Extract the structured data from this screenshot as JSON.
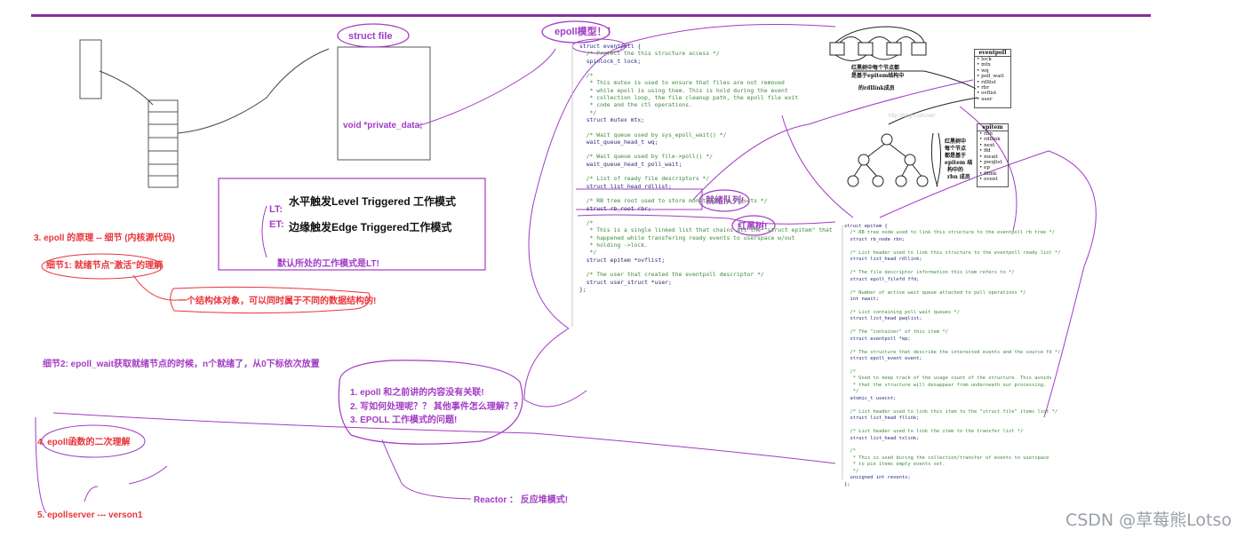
{
  "left_notes": {
    "struct_file": "struct file",
    "private_data": "void *private_data;",
    "lt_label": "LT:",
    "et_label": "ET:",
    "level_triggered": "水平触发Level Triggered 工作模式",
    "edge_triggered": "边缘触发Edge Triggered工作模式",
    "default_mode": "默认所处的工作模式是LT!",
    "epoll_principle": "3. epoll 的原理 -- 细节 (内核源代码)",
    "detail1": "细节1: 就绪节点\"激活\"的理解",
    "struct_object": "一个结构体对象，可以同时属于不同的数据结构的!",
    "detail2": "细节2: epoll_wait获取就绪节点的时候，n个就绪了，从0下标依次放置",
    "questions": [
      "1. epoll 和之前讲的内容没有关联!",
      "2. 写如何处理呢？？ 其他事件怎么理解？？",
      "3. EPOLL 工作模式的问题!"
    ],
    "epoll_func": "4. epoll函数的二次理解",
    "epollserver": "5. epollserver --- verson1",
    "reactor": "Reactor ：  反应堆模式!"
  },
  "middle_notes": {
    "epoll_model": "epoll模型！！",
    "ready_queue": "就绪队列!",
    "rb_tree": "红黑树!"
  },
  "eventpoll_code": [
    {
      "t": "struct eventpoll {",
      "c": false
    },
    {
      "t": "  /* Protect the this structure access */",
      "c": true
    },
    {
      "t": "  spinlock_t lock;",
      "c": false
    },
    {
      "t": "",
      "c": false
    },
    {
      "t": "  /*",
      "c": true
    },
    {
      "t": "   * This mutex is used to ensure that files are not removed",
      "c": true
    },
    {
      "t": "   * while epoll is using them. This is hold during the event",
      "c": true
    },
    {
      "t": "   * collection loop, the file cleanup path, the epoll file exit",
      "c": true
    },
    {
      "t": "   * code and the ctl operations.",
      "c": true
    },
    {
      "t": "   */",
      "c": true
    },
    {
      "t": "  struct mutex mtx;",
      "c": false
    },
    {
      "t": "",
      "c": false
    },
    {
      "t": "  /* Wait queue used by sys_epoll_wait() */",
      "c": true
    },
    {
      "t": "  wait_queue_head_t wq;",
      "c": false
    },
    {
      "t": "",
      "c": false
    },
    {
      "t": "  /* Wait queue used by file->poll() */",
      "c": true
    },
    {
      "t": "  wait_queue_head_t poll_wait;",
      "c": false
    },
    {
      "t": "",
      "c": false
    },
    {
      "t": "  /* List of ready file descriptors */",
      "c": true
    },
    {
      "t": "  struct list_head rdllist;",
      "c": false
    },
    {
      "t": "",
      "c": false
    },
    {
      "t": "  /* RB tree root used to store monitored fd structs */",
      "c": true
    },
    {
      "t": "  struct rb_root rbr;",
      "c": false
    },
    {
      "t": "",
      "c": false
    },
    {
      "t": "  /*",
      "c": true
    },
    {
      "t": "   * This is a single linked list that chains all the \"struct epitem\" that",
      "c": true
    },
    {
      "t": "   * happened while transfering ready events to userspace w/out",
      "c": true
    },
    {
      "t": "   * holding ->lock.",
      "c": true
    },
    {
      "t": "   */",
      "c": true
    },
    {
      "t": "  struct epitem *ovflist;",
      "c": false
    },
    {
      "t": "",
      "c": false
    },
    {
      "t": "  /* The user that created the eventpoll descriptor */",
      "c": true
    },
    {
      "t": "  struct user_struct *user;",
      "c": false
    },
    {
      "t": "};",
      "c": false
    }
  ],
  "epitem_code": [
    {
      "t": "struct epitem {",
      "c": false
    },
    {
      "t": "  /* RB tree node used to link this structure to the eventpoll rb tree */",
      "c": true
    },
    {
      "t": "  struct rb_node rbn;",
      "c": false
    },
    {
      "t": "",
      "c": false
    },
    {
      "t": "  /* List header used to link this structure to the eventpoll ready list */",
      "c": true
    },
    {
      "t": "  struct list_head rdllink;",
      "c": false
    },
    {
      "t": "",
      "c": false
    },
    {
      "t": "  /* The file descriptor information this item refers to */",
      "c": true
    },
    {
      "t": "  struct epoll_filefd ffd;",
      "c": false
    },
    {
      "t": "",
      "c": false
    },
    {
      "t": "  /* Number of active wait queue attached to poll operations */",
      "c": true
    },
    {
      "t": "  int nwait;",
      "c": false
    },
    {
      "t": "",
      "c": false
    },
    {
      "t": "  /* List containing poll wait queues */",
      "c": true
    },
    {
      "t": "  struct list_head pwqlist;",
      "c": false
    },
    {
      "t": "",
      "c": false
    },
    {
      "t": "  /* The \"container\" of this item */",
      "c": true
    },
    {
      "t": "  struct eventpoll *ep;",
      "c": false
    },
    {
      "t": "",
      "c": false
    },
    {
      "t": "  /* The structure that describe the interested events and the source fd */",
      "c": true
    },
    {
      "t": "  struct epoll_event event;",
      "c": false
    },
    {
      "t": "",
      "c": false
    },
    {
      "t": "  /*",
      "c": true
    },
    {
      "t": "   * Used to keep track of the usage count of the structure. This avoids",
      "c": true
    },
    {
      "t": "   * that the structure will desappear from underneath our processing.",
      "c": true
    },
    {
      "t": "   */",
      "c": true
    },
    {
      "t": "  atomic_t usecnt;",
      "c": false
    },
    {
      "t": "",
      "c": false
    },
    {
      "t": "  /* List header used to link this item to the \"struct file\" items list */",
      "c": true
    },
    {
      "t": "  struct list_head fllink;",
      "c": false
    },
    {
      "t": "",
      "c": false
    },
    {
      "t": "  /* List header used to link the item to the transfer list */",
      "c": true
    },
    {
      "t": "  struct list_head txlink;",
      "c": false
    },
    {
      "t": "",
      "c": false
    },
    {
      "t": "  /*",
      "c": true
    },
    {
      "t": "   * This is used during the collection/transfer of events to userspace",
      "c": true
    },
    {
      "t": "   * to pin items empty events set.",
      "c": true
    },
    {
      "t": "   */",
      "c": true
    },
    {
      "t": "  unsigned int revents;",
      "c": false
    },
    {
      "t": "};",
      "c": false
    }
  ],
  "diagram": {
    "eventpoll_title": "eventpoll",
    "eventpoll_fields": [
      "lock",
      "mtx",
      "wq",
      "poll_wait",
      "rdllist",
      "rbr",
      "ovflist",
      "user"
    ],
    "epitem_title": "epitem",
    "epitem_fields": [
      "rbn",
      "rdllink",
      "next",
      "ffd",
      "nwait",
      "pwqlist",
      "ep",
      "fllink",
      "event"
    ],
    "list_caption": [
      "红黑树中每个节点都",
      "是基于epitem结构中",
      "的rdllink成员"
    ],
    "tree_caption": [
      "红黑树中",
      "每个节点",
      "都是基于",
      "epitem 结",
      "构中的",
      "rbn 成员"
    ],
    "faded_url": "http://blog.csdn.net/"
  },
  "watermark": "CSDN @草莓熊Lotso",
  "colors": {
    "purple": "#a23cc4",
    "red": "#e8343a",
    "header_line": "#8a2e9e"
  }
}
